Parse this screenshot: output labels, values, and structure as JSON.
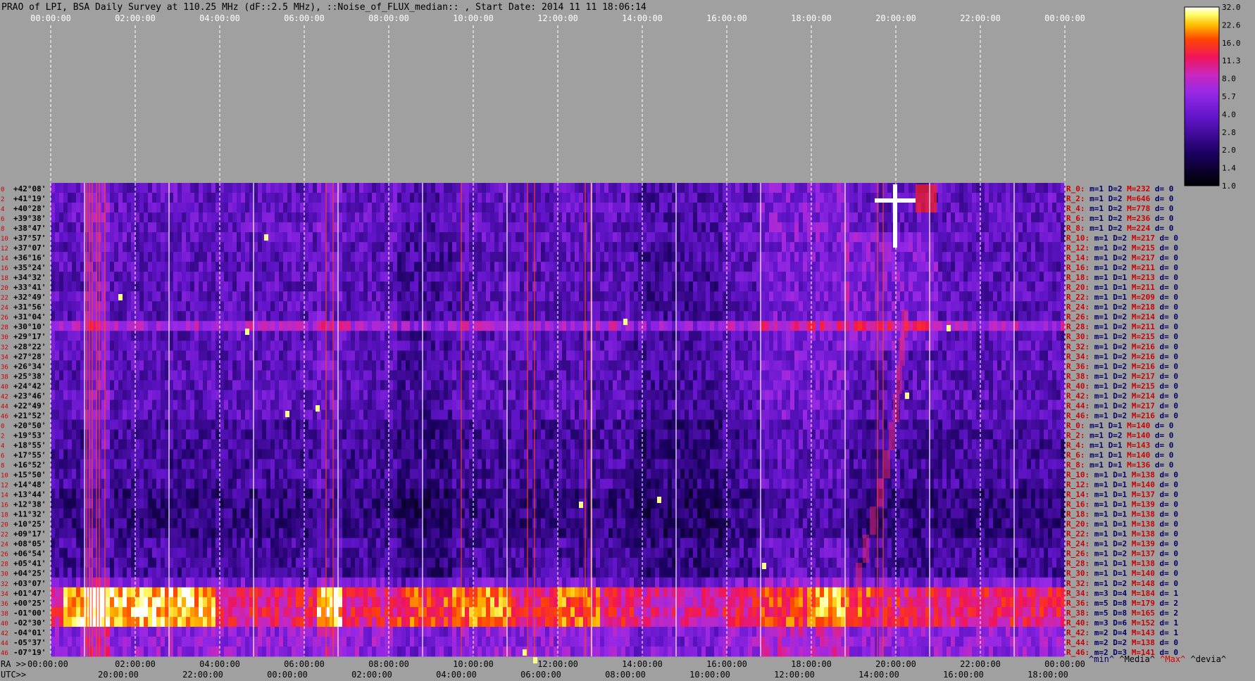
{
  "chart_data": {
    "type": "heatmap",
    "title": "PRAO of LPI, BSA Daily Survey at 110.25 MHz (dF::2.5 MHz), ::Noise_of_FLUX_median:: , Start Date: 2014 11 11 18:06:14",
    "x_top_ticks": [
      "00:00:00",
      "02:00:00",
      "04:00:00",
      "06:00:00",
      "08:00:00",
      "10:00:00",
      "12:00:00",
      "14:00:00",
      "16:00:00",
      "18:00:00",
      "20:00:00",
      "22:00:00",
      "00:00:00"
    ],
    "x_bottom_prefix_ra": "RA >>",
    "x_bottom_prefix_utc": "UTC>>",
    "x_bottom_ra_ticks": [
      "00:00:00",
      "02:00:00",
      "04:00:00",
      "06:00:00",
      "08:00:00",
      "10:00:00",
      "12:00:00",
      "14:00:00",
      "16:00:00",
      "18:00:00",
      "20:00:00",
      "22:00:00",
      "00:00:00"
    ],
    "x_bottom_utc_ticks": [
      "20:00:00",
      "22:00:00",
      "00:00:00",
      "02:00:00",
      "04:00:00",
      "06:00:00",
      "08:00:00",
      "10:00:00",
      "12:00:00",
      "14:00:00",
      "16:00:00",
      "18:00:00"
    ],
    "y_dec_labels": [
      "+42°08'",
      "+41°19'",
      "+40°28'",
      "+39°38'",
      "+38°47'",
      "+37°57'",
      "+37°07'",
      "+36°16'",
      "+35°24'",
      "+34°32'",
      "+33°41'",
      "+32°49'",
      "+31°56'",
      "+31°04'",
      "+30°10'",
      "+29°17'",
      "+28°22'",
      "+27°28'",
      "+26°34'",
      "+25°38'",
      "+24°42'",
      "+23°46'",
      "+22°49'",
      "+21°52'",
      "+20°50'",
      "+19°53'",
      "+18°55'",
      "+17°55'",
      "+16°52'",
      "+15°50'",
      "+14°48'",
      "+13°44'",
      "+12°38'",
      "+11°32'",
      "+10°25'",
      "+09°17'",
      "+08°05'",
      "+06°54'",
      "+05°41'",
      "+04°25'",
      "+03°07'",
      "+01°47'",
      "+00°25'",
      "-01°00'",
      "-02°30'",
      "-04°01'",
      "-05°37'",
      "-07°19'"
    ],
    "row_stats": [
      "R_0: m=1 D=2 M=232 d= 0",
      "R_2: m=1 D=2 M=646 d= 0",
      "R_4: m=1 D=2 M=778 d= 0",
      "R_6: m=1 D=2 M=236 d= 0",
      "R_8: m=1 D=2 M=224 d= 0",
      "R_10: m=1 D=2 M=217 d= 0",
      "R_12: m=1 D=2 M=215 d= 0",
      "R_14: m=1 D=2 M=217 d= 0",
      "R_16: m=1 D=2 M=211 d= 0",
      "R_18: m=1 D=1 M=213 d= 0",
      "R_20: m=1 D=1 M=211 d= 0",
      "R_22: m=1 D=1 M=209 d= 0",
      "R_24: m=1 D=2 M=218 d= 0",
      "R_26: m=1 D=2 M=214 d= 0",
      "R_28: m=1 D=2 M=211 d= 0",
      "R_30: m=1 D=2 M=215 d= 0",
      "R_32: m=1 D=2 M=216 d= 0",
      "R_34: m=1 D=2 M=216 d= 0",
      "R_36: m=1 D=2 M=216 d= 0",
      "R_38: m=1 D=2 M=217 d= 0",
      "R_40: m=1 D=2 M=215 d= 0",
      "R_42: m=1 D=2 M=214 d= 0",
      "R_44: m=1 D=2 M=217 d= 0",
      "R_46: m=1 D=2 M=216 d= 0",
      "R_0: m=1 D=1 M=140 d= 0",
      "R_2: m=1 D=2 M=140 d= 0",
      "R_4: m=1 D=1 M=143 d= 0",
      "R_6: m=1 D=1 M=140 d= 0",
      "R_8: m=1 D=1 M=136 d= 0",
      "R_10: m=1 D=1 M=138 d= 0",
      "R_12: m=1 D=1 M=140 d= 0",
      "R_14: m=1 D=1 M=137 d= 0",
      "R_16: m=1 D=1 M=139 d= 0",
      "R_18: m=1 D=1 M=138 d= 0",
      "R_20: m=1 D=1 M=138 d= 0",
      "R_22: m=1 D=1 M=138 d= 0",
      "R_24: m=1 D=2 M=139 d= 0",
      "R_26: m=1 D=2 M=137 d= 0",
      "R_28: m=1 D=1 M=138 d= 0",
      "R_30: m=1 D=1 M=140 d= 0",
      "R_32: m=1 D=2 M=148 d= 0",
      "R_34: m=3 D=4 M=184 d= 1",
      "R_36: m=5 D=8 M=179 d= 2",
      "R_38: m=5 D=8 M=165 d= 2",
      "R_40: m=3 D=6 M=152 d= 1",
      "R_42: m=2 D=4 M=143 d= 1",
      "R_44: m=2 D=2 M=138 d= 0",
      "R_46: m=2 D=3 M=141 d= 0"
    ],
    "stats_footer": [
      "^min^",
      "^Media^",
      "^Max^",
      "^devia^"
    ],
    "colorbar_ticks": [
      "32.0",
      "22.6",
      "16.0",
      "11.3",
      "8.0",
      "5.7",
      "4.0",
      "2.8",
      "2.0",
      "1.4",
      "1.0"
    ],
    "colorbar_range": [
      1.0,
      32.0
    ],
    "colorbar_scale": "log",
    "grid": true,
    "colors": {
      "background": "#a0a0a0",
      "low": "#000000",
      "mid": "#7b1fe0",
      "high": "#ff2000",
      "max": "#ffffff"
    }
  }
}
